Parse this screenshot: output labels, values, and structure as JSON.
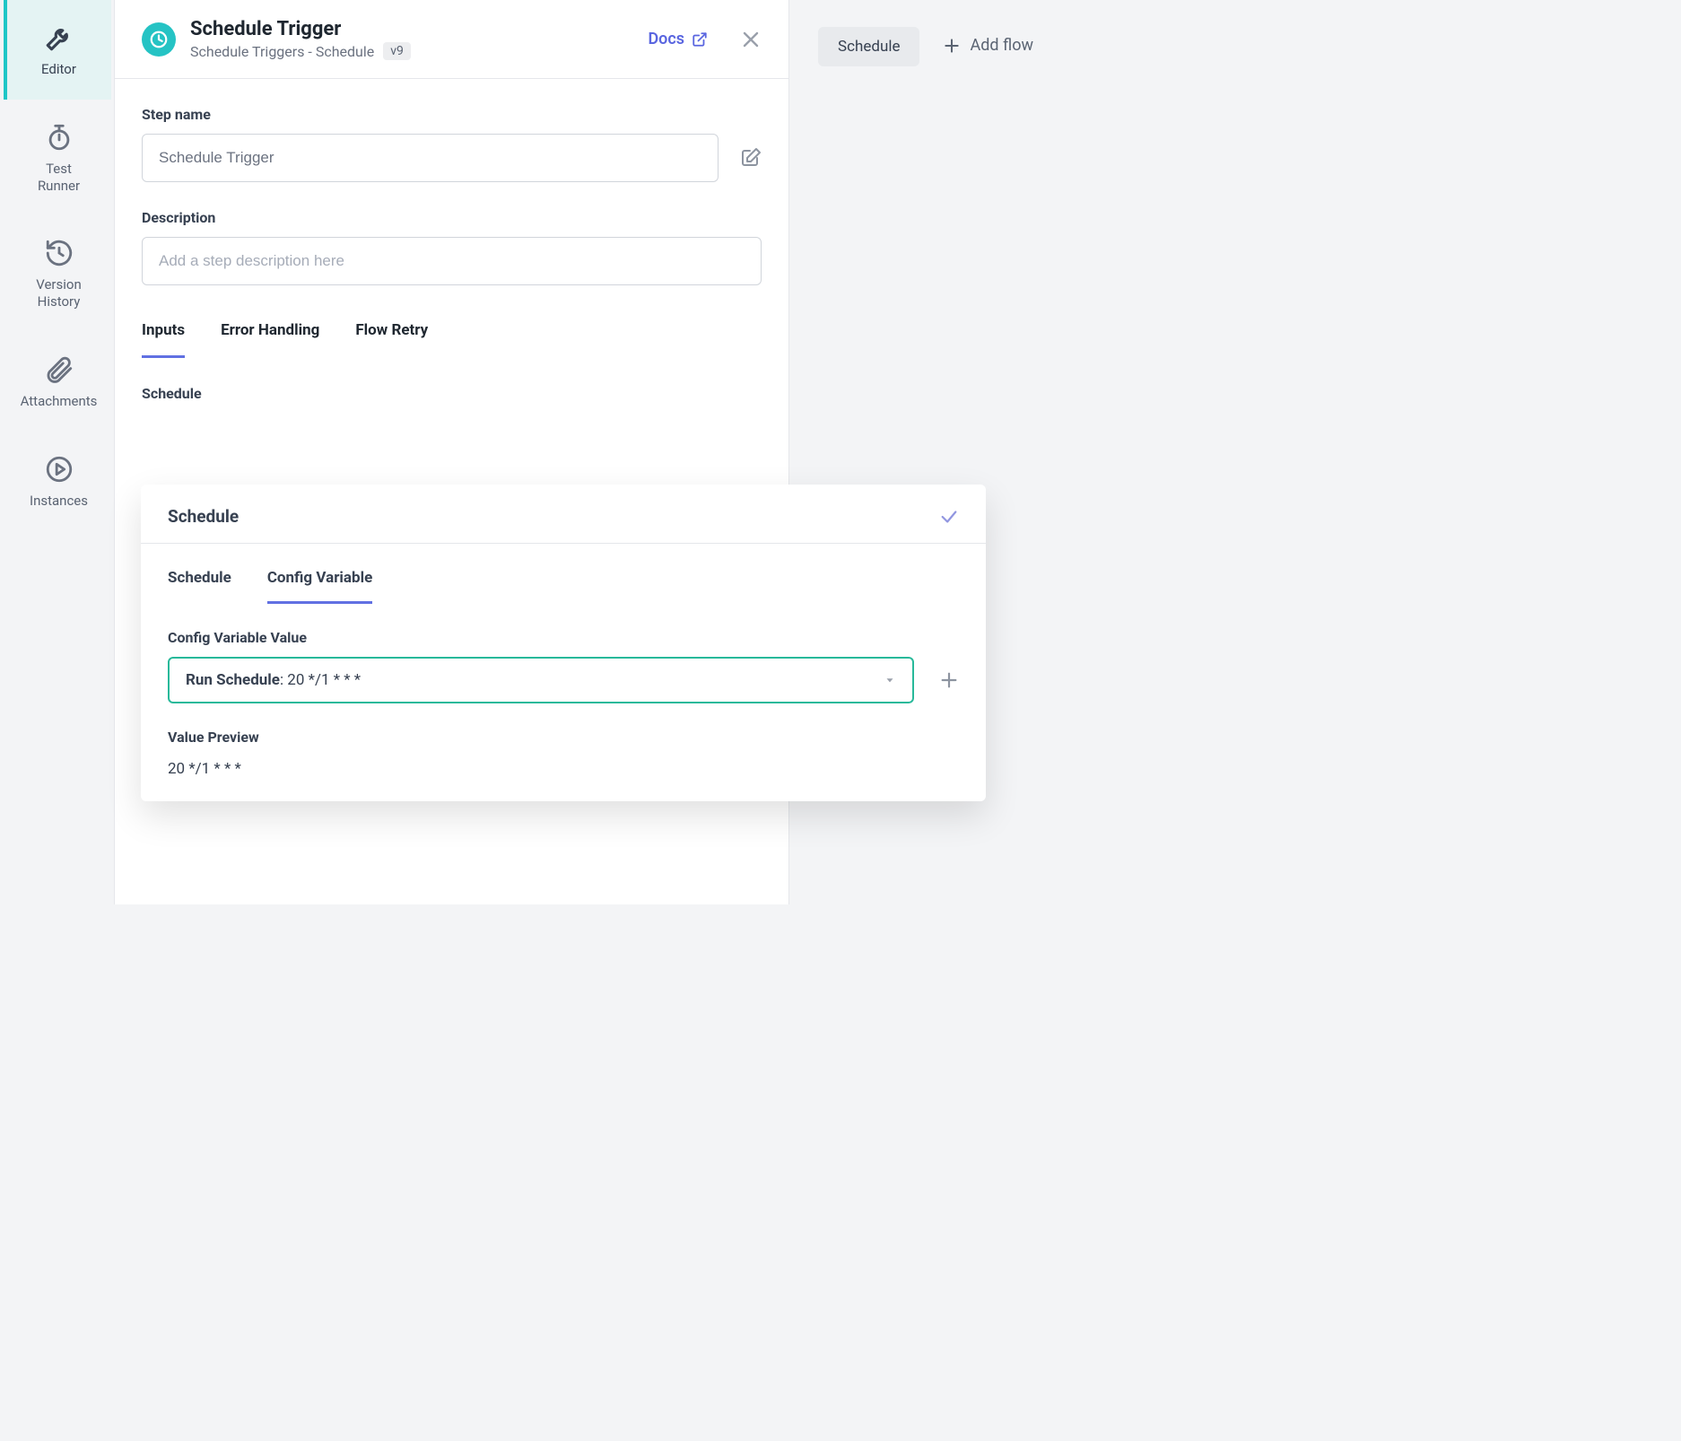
{
  "sidebar": {
    "items": [
      {
        "label": "Editor"
      },
      {
        "label": "Test\nRunner"
      },
      {
        "label": "Version\nHistory"
      },
      {
        "label": "Attachments"
      },
      {
        "label": "Instances"
      }
    ]
  },
  "header": {
    "title": "Schedule Trigger",
    "subtitle": "Schedule Triggers - Schedule",
    "version": "v9",
    "docs_label": "Docs"
  },
  "fields": {
    "step_name_label": "Step name",
    "step_name_value": "Schedule Trigger",
    "description_label": "Description",
    "description_placeholder": "Add a step description here"
  },
  "tabs": [
    {
      "label": "Inputs"
    },
    {
      "label": "Error Handling"
    },
    {
      "label": "Flow Retry"
    }
  ],
  "section_label": "Schedule",
  "right": {
    "pill": "Schedule",
    "add_flow": "Add flow"
  },
  "card": {
    "title": "Schedule",
    "tabs": [
      {
        "label": "Schedule"
      },
      {
        "label": "Config Variable"
      }
    ],
    "config_label": "Config Variable Value",
    "select": {
      "label": "Run Schedule",
      "value": ": 20 */1 * * *"
    },
    "preview_label": "Value Preview",
    "preview_value": "20 */1 * * *"
  }
}
